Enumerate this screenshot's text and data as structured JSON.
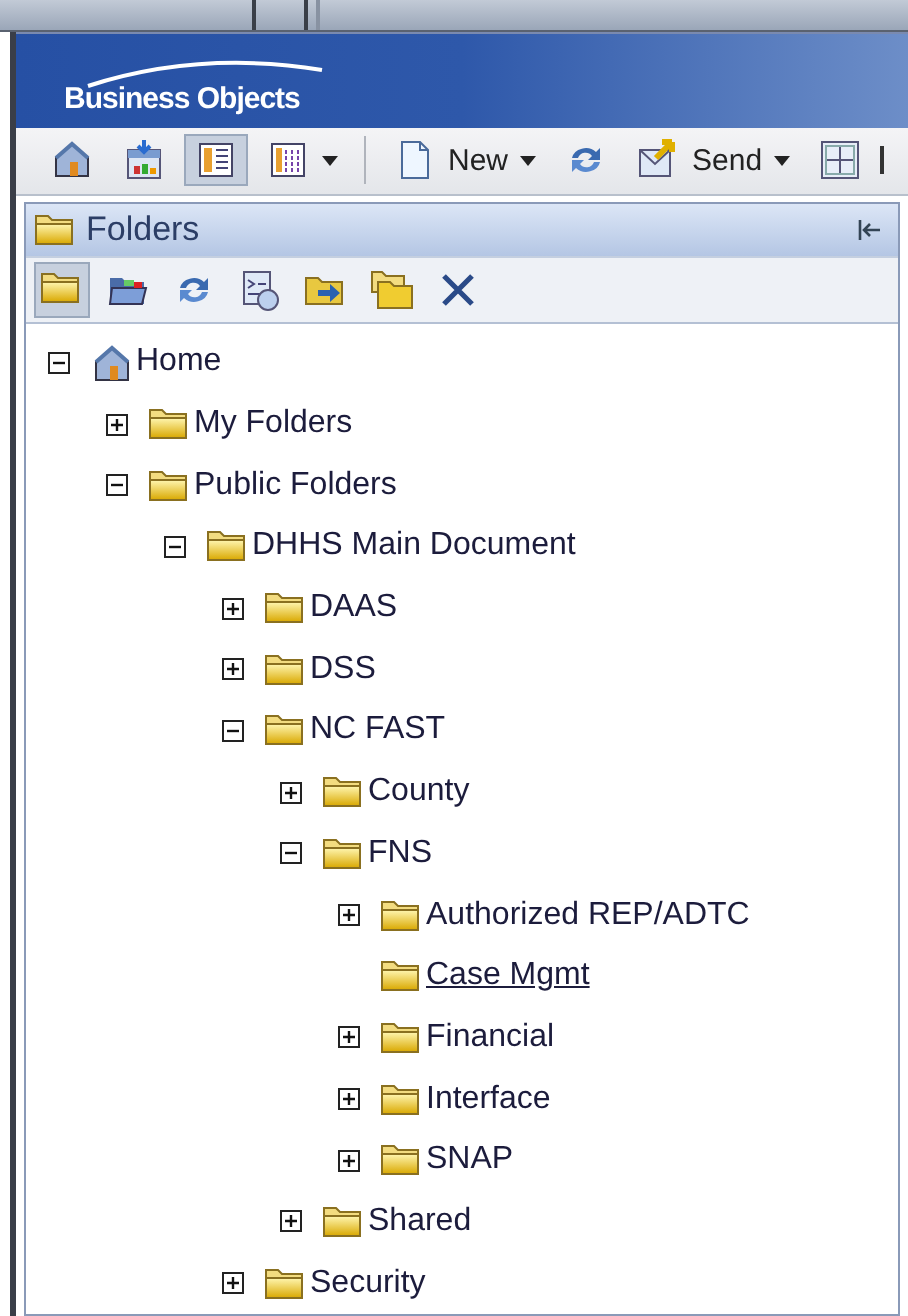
{
  "header": {
    "logo": "Business Objects"
  },
  "toolbar": [
    {
      "kind": "home",
      "pressed": false,
      "dropdown": false
    },
    {
      "kind": "schedule",
      "pressed": false,
      "dropdown": false
    },
    {
      "kind": "list-view",
      "pressed": true,
      "dropdown": false
    },
    {
      "kind": "details-view",
      "pressed": false,
      "dropdown": true
    },
    {
      "kind": "separator"
    },
    {
      "kind": "document",
      "label": "New",
      "pressed": false,
      "dropdown": true
    },
    {
      "kind": "refresh",
      "pressed": false,
      "dropdown": false
    },
    {
      "kind": "send",
      "label": "Send",
      "pressed": false,
      "dropdown": true
    },
    {
      "kind": "grid",
      "pressed": false,
      "dropdown": false
    }
  ],
  "panel": {
    "title": "Folders",
    "toolbar": [
      {
        "kind": "folder",
        "pressed": true
      },
      {
        "kind": "open-folder",
        "pressed": false
      },
      {
        "kind": "refresh",
        "pressed": false
      },
      {
        "kind": "properties",
        "pressed": false
      },
      {
        "kind": "move",
        "pressed": false
      },
      {
        "kind": "copy",
        "pressed": false
      },
      {
        "kind": "delete",
        "pressed": false
      }
    ],
    "tree": [
      {
        "label": "Home",
        "kind": "home",
        "expanded": true,
        "hovered": false,
        "children": [
          {
            "label": "My Folders",
            "kind": "folder",
            "expanded": false,
            "hovered": false
          },
          {
            "label": "Public Folders",
            "kind": "folder",
            "expanded": true,
            "hovered": false,
            "children": [
              {
                "label": "DHHS Main Document",
                "kind": "folder",
                "expanded": true,
                "hovered": false,
                "children": [
                  {
                    "label": "DAAS",
                    "kind": "folder",
                    "expanded": false,
                    "hovered": false
                  },
                  {
                    "label": "DSS",
                    "kind": "folder",
                    "expanded": false,
                    "hovered": false
                  },
                  {
                    "label": "NC FAST",
                    "kind": "folder",
                    "expanded": true,
                    "hovered": false,
                    "children": [
                      {
                        "label": "County",
                        "kind": "folder",
                        "expanded": false,
                        "hovered": false
                      },
                      {
                        "label": "FNS",
                        "kind": "folder",
                        "expanded": true,
                        "hovered": false,
                        "children": [
                          {
                            "label": "Authorized REP/ADTC",
                            "kind": "folder",
                            "expanded": false,
                            "hovered": false
                          },
                          {
                            "label": "Case Mgmt",
                            "kind": "folder",
                            "hovered": true
                          },
                          {
                            "label": "Financial",
                            "kind": "folder",
                            "expanded": false,
                            "hovered": false
                          },
                          {
                            "label": "Interface",
                            "kind": "folder",
                            "expanded": false,
                            "hovered": false
                          },
                          {
                            "label": "SNAP",
                            "kind": "folder",
                            "expanded": false,
                            "hovered": false
                          }
                        ]
                      },
                      {
                        "label": "Shared",
                        "kind": "folder",
                        "expanded": false,
                        "hovered": false
                      }
                    ]
                  },
                  {
                    "label": "Security",
                    "kind": "folder",
                    "expanded": false,
                    "hovered": false
                  }
                ]
              }
            ]
          }
        ]
      }
    ]
  }
}
